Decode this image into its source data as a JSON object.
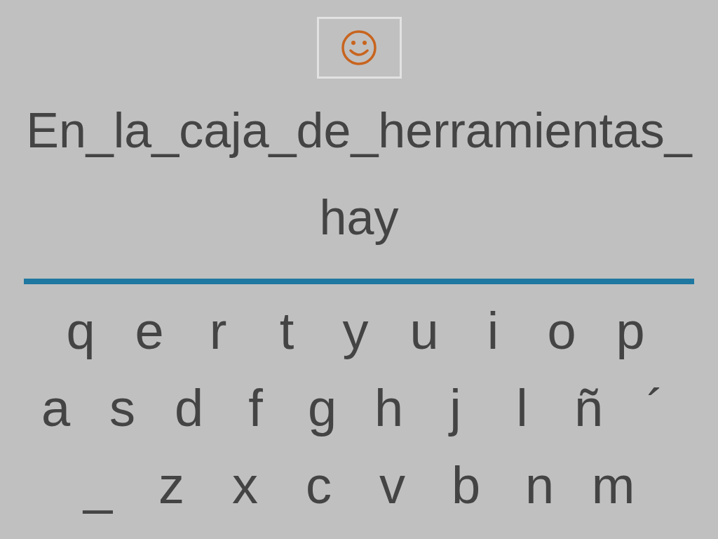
{
  "sentence": {
    "lines": [
      "En_la_caja_de_herramientas_",
      "hay"
    ]
  },
  "keyboard": {
    "rows": [
      {
        "keys": [
          "q",
          "e",
          "r",
          "t",
          "y",
          "u",
          "i",
          "o",
          "p"
        ]
      },
      {
        "keys": [
          "a",
          "s",
          "d",
          "f",
          "g",
          "h",
          "j",
          "l",
          "ñ",
          "´"
        ]
      },
      {
        "keys": [
          "_",
          "z",
          "x",
          "c",
          "v",
          "b",
          "n",
          "m"
        ]
      }
    ]
  }
}
